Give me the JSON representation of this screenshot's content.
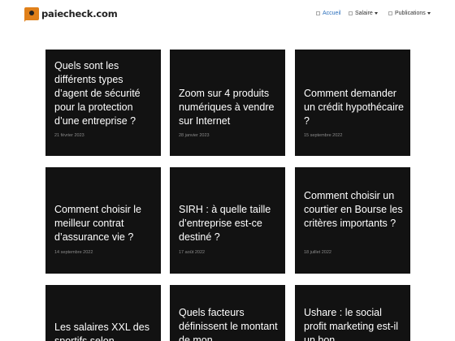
{
  "site": {
    "name": "paiecheck.com"
  },
  "nav": [
    {
      "label": "Accueil",
      "active": true,
      "dropdown": false
    },
    {
      "label": "Salaire",
      "active": false,
      "dropdown": true
    },
    {
      "label": "Publications",
      "active": false,
      "dropdown": true
    }
  ],
  "articles": [
    {
      "title": "Quels sont les différents types d’agent de sécurité pour la protection d’une entreprise ?",
      "date": "21 février 2023"
    },
    {
      "title": "Zoom sur 4 produits numériques à vendre sur Internet",
      "date": "28 janvier 2023"
    },
    {
      "title": "Comment demander un crédit hypothécaire ?",
      "date": "15 septembre 2022"
    },
    {
      "title": "Comment choisir le meilleur contrat d’assurance vie ?",
      "date": "14 septembre 2022"
    },
    {
      "title": "SIRH : à quelle taille d’entreprise est-ce destiné ?",
      "date": "17 août 2022"
    },
    {
      "title": "Comment choisir un courtier en Bourse les critères importants ?",
      "date": "18 juillet 2022"
    },
    {
      "title": "Les salaires XXL des sportifs selon",
      "date": ""
    },
    {
      "title": "Quels facteurs définissent le montant de mon",
      "date": ""
    },
    {
      "title": "Ushare : le social profit marketing est-il un bon",
      "date": ""
    }
  ]
}
